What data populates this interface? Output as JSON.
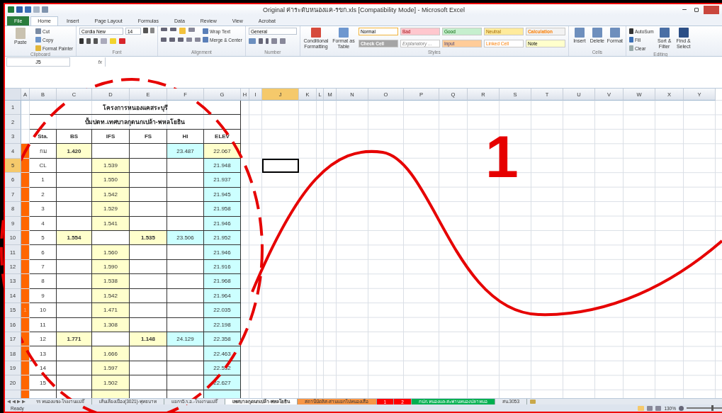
{
  "window": {
    "title": "Original ค่าระดับหนองแค-รขก.xls  [Compatibility Mode]  -  Microsoft Excel"
  },
  "tabs": [
    {
      "label": "File",
      "selected": false,
      "kind": "file"
    },
    {
      "label": "Home",
      "selected": true,
      "kind": "tab"
    },
    {
      "label": "Insert",
      "selected": false,
      "kind": "tab"
    },
    {
      "label": "Page Layout",
      "selected": false,
      "kind": "tab"
    },
    {
      "label": "Formulas",
      "selected": false,
      "kind": "tab"
    },
    {
      "label": "Data",
      "selected": false,
      "kind": "tab"
    },
    {
      "label": "Review",
      "selected": false,
      "kind": "tab"
    },
    {
      "label": "View",
      "selected": false,
      "kind": "tab"
    },
    {
      "label": "Acrobat",
      "selected": false,
      "kind": "tab"
    }
  ],
  "ribbon": {
    "clipboard": {
      "label": "Clipboard",
      "paste": "Paste",
      "cut": "Cut",
      "copy": "Copy",
      "painter": "Format Painter"
    },
    "font": {
      "label": "Font",
      "name": "Cordia New",
      "size": "14"
    },
    "alignment": {
      "label": "Alignment",
      "wrap": "Wrap Text",
      "merge": "Merge & Center"
    },
    "number": {
      "label": "Number",
      "format": "General"
    },
    "styles": {
      "label": "Styles",
      "conditional": "Conditional Formatting",
      "table": "Format as Table",
      "cells": [
        {
          "text": "Normal",
          "kind": "normal",
          "selected": true
        },
        {
          "text": "Bad",
          "kind": "bad",
          "selected": false
        },
        {
          "text": "Good",
          "kind": "good",
          "selected": false
        },
        {
          "text": "Neutral",
          "kind": "neutral",
          "selected": false
        },
        {
          "text": "Calculation",
          "kind": "calculation",
          "selected": false
        },
        {
          "text": "Check Cell",
          "kind": "check",
          "selected": false
        },
        {
          "text": "Explanatory ...",
          "kind": "explanatory",
          "selected": false
        },
        {
          "text": "Input",
          "kind": "input",
          "selected": false
        },
        {
          "text": "Linked Cell",
          "kind": "linked",
          "selected": false
        },
        {
          "text": "Note",
          "kind": "note",
          "selected": false
        }
      ]
    },
    "cells": {
      "label": "Cells",
      "buttons": [
        "Insert",
        "Delete",
        "Format"
      ]
    },
    "editing": {
      "label": "Editing",
      "autosum": "AutoSum",
      "fill": "Fill",
      "clear": "Clear",
      "sort": "Sort & Filter",
      "find": "Find & Select"
    }
  },
  "name_box": "J5",
  "function_label": "fx",
  "columns": [
    {
      "label": "A",
      "selected": false
    },
    {
      "label": "B",
      "selected": false
    },
    {
      "label": "C",
      "selected": false
    },
    {
      "label": "D",
      "selected": false
    },
    {
      "label": "E",
      "selected": false
    },
    {
      "label": "F",
      "selected": false
    },
    {
      "label": "G",
      "selected": false
    },
    {
      "label": "H",
      "selected": false
    },
    {
      "label": "I",
      "selected": false
    },
    {
      "label": "J",
      "selected": true
    },
    {
      "label": "K",
      "selected": false
    },
    {
      "label": "L",
      "selected": false
    },
    {
      "label": "M",
      "selected": false
    },
    {
      "label": "N",
      "selected": false
    },
    {
      "label": "O",
      "selected": false
    },
    {
      "label": "P",
      "selected": false
    },
    {
      "label": "Q",
      "selected": false
    },
    {
      "label": "R",
      "selected": false
    },
    {
      "label": "S",
      "selected": false
    },
    {
      "label": "T",
      "selected": false
    },
    {
      "label": "U",
      "selected": false
    },
    {
      "label": "V",
      "selected": false
    },
    {
      "label": "W",
      "selected": false
    },
    {
      "label": "X",
      "selected": false
    },
    {
      "label": "Y",
      "selected": false
    }
  ],
  "rows": [
    {
      "header": "1",
      "selected": false,
      "kind": "title",
      "text": "โครงการหนองแคสระบุรี"
    },
    {
      "header": "2",
      "selected": false,
      "kind": "title",
      "text": "ปั้มปตท.เทศบาลกุดนกเปล้า-พหลโยธิน"
    },
    {
      "header": "3",
      "selected": false,
      "kind": "data",
      "cells": [
        null,
        {
          "text": "Sta.",
          "bold": true
        },
        {
          "text": "BS",
          "bold": true
        },
        {
          "text": "IFS",
          "bold": true
        },
        {
          "text": "FS",
          "bold": true
        },
        {
          "text": "HI",
          "bold": true
        },
        {
          "text": "ELEV",
          "bold": true
        }
      ]
    },
    {
      "header": "4",
      "selected": false,
      "kind": "data",
      "cells": [
        {
          "color": "#ff6600"
        },
        {
          "text": "กม"
        },
        {
          "text": "1.420",
          "color": "#ffffcc",
          "bold": true
        },
        null,
        null,
        {
          "text": "23.487",
          "color": "#ccffff"
        },
        {
          "text": "22.067",
          "color": "#ffffcc"
        }
      ]
    },
    {
      "header": "5",
      "selected": true,
      "kind": "data",
      "cells": [
        {
          "color": "#ff6600"
        },
        {
          "text": "CL"
        },
        null,
        {
          "text": "1.539",
          "color": "#ffffcc"
        },
        null,
        null,
        {
          "text": "21.948",
          "color": "#ccffff"
        }
      ]
    },
    {
      "header": "6",
      "selected": false,
      "kind": "data",
      "cells": [
        {
          "color": "#ff6600"
        },
        {
          "text": "1"
        },
        null,
        {
          "text": "1.550",
          "color": "#ffffcc"
        },
        null,
        null,
        {
          "text": "21.937",
          "color": "#ccffff"
        }
      ]
    },
    {
      "header": "7",
      "selected": false,
      "kind": "data",
      "cells": [
        {
          "color": "#ff6600"
        },
        {
          "text": "2"
        },
        null,
        {
          "text": "1.542",
          "color": "#ffffcc"
        },
        null,
        null,
        {
          "text": "21.945",
          "color": "#ccffff"
        }
      ]
    },
    {
      "header": "8",
      "selected": false,
      "kind": "data",
      "cells": [
        {
          "color": "#ff6600"
        },
        {
          "text": "3"
        },
        null,
        {
          "text": "1.529",
          "color": "#ffffcc"
        },
        null,
        null,
        {
          "text": "21.958",
          "color": "#ccffff"
        }
      ]
    },
    {
      "header": "9",
      "selected": false,
      "kind": "data",
      "cells": [
        {
          "color": "#ff6600"
        },
        {
          "text": "4"
        },
        null,
        {
          "text": "1.541",
          "color": "#ffffcc"
        },
        null,
        null,
        {
          "text": "21.946",
          "color": "#ccffff"
        }
      ]
    },
    {
      "header": "10",
      "selected": false,
      "kind": "data",
      "cells": [
        {
          "color": "#ff6600"
        },
        {
          "text": "5"
        },
        {
          "text": "1.554",
          "color": "#ffffcc",
          "bold": true
        },
        null,
        {
          "text": "1.535",
          "color": "#ffffcc",
          "bold": true
        },
        {
          "text": "23.506",
          "color": "#ccffff"
        },
        {
          "text": "21.952",
          "color": "#ccffff"
        }
      ]
    },
    {
      "header": "11",
      "selected": false,
      "kind": "data",
      "cells": [
        {
          "color": "#ff6600"
        },
        {
          "text": "6"
        },
        null,
        {
          "text": "1.560",
          "color": "#ffffcc"
        },
        null,
        null,
        {
          "text": "21.946",
          "color": "#ccffff"
        }
      ]
    },
    {
      "header": "12",
      "selected": false,
      "kind": "data",
      "cells": [
        {
          "color": "#ff6600"
        },
        {
          "text": "7"
        },
        null,
        {
          "text": "1.590",
          "color": "#ffffcc"
        },
        null,
        null,
        {
          "text": "21.916",
          "color": "#ccffff"
        }
      ]
    },
    {
      "header": "13",
      "selected": false,
      "kind": "data",
      "cells": [
        {
          "color": "#ff6600"
        },
        {
          "text": "8"
        },
        null,
        {
          "text": "1.538",
          "color": "#ffffcc"
        },
        null,
        null,
        {
          "text": "21.968",
          "color": "#ccffff"
        }
      ]
    },
    {
      "header": "14",
      "selected": false,
      "kind": "data",
      "cells": [
        {
          "color": "#ff6600"
        },
        {
          "text": "9"
        },
        null,
        {
          "text": "1.542",
          "color": "#ffffcc"
        },
        null,
        null,
        {
          "text": "21.964",
          "color": "#ccffff"
        }
      ]
    },
    {
      "header": "15",
      "selected": false,
      "kind": "data",
      "cells": [
        {
          "color": "#ff6600",
          "text": "1"
        },
        {
          "text": "10"
        },
        null,
        {
          "text": "1.471",
          "color": "#ffffcc"
        },
        null,
        null,
        {
          "text": "22.035",
          "color": "#ccffff"
        }
      ]
    },
    {
      "header": "16",
      "selected": false,
      "kind": "data",
      "cells": [
        {
          "color": "#ff6600"
        },
        {
          "text": "11"
        },
        null,
        {
          "text": "1.308",
          "color": "#ffffcc"
        },
        null,
        null,
        {
          "text": "22.198",
          "color": "#ccffff"
        }
      ]
    },
    {
      "header": "17",
      "selected": false,
      "kind": "data",
      "cells": [
        {
          "color": "#ff6600"
        },
        {
          "text": "12"
        },
        {
          "text": "1.771",
          "color": "#ffffcc",
          "bold": true
        },
        null,
        {
          "text": "1.148",
          "color": "#ffffcc",
          "bold": true
        },
        {
          "text": "24.129",
          "color": "#ccffff"
        },
        {
          "text": "22.358",
          "color": "#ccffff"
        }
      ]
    },
    {
      "header": "18",
      "selected": false,
      "kind": "data",
      "cells": [
        {
          "color": "#ff6600"
        },
        {
          "text": "13"
        },
        null,
        {
          "text": "1.666",
          "color": "#ffffcc"
        },
        null,
        null,
        {
          "text": "22.463",
          "color": "#ccffff"
        }
      ]
    },
    {
      "header": "19",
      "selected": false,
      "kind": "data",
      "cells": [
        {
          "color": "#ff6600"
        },
        {
          "text": "14"
        },
        null,
        {
          "text": "1.597",
          "color": "#ffffcc"
        },
        null,
        null,
        {
          "text": "22.532",
          "color": "#ccffff"
        }
      ]
    },
    {
      "header": "20",
      "selected": false,
      "kind": "data",
      "cells": [
        {
          "color": "#ff6600"
        },
        {
          "text": "15"
        },
        null,
        {
          "text": "1.502",
          "color": "#ffffcc"
        },
        null,
        null,
        {
          "text": "22.627",
          "color": "#ccffff"
        }
      ]
    },
    {
      "selected": false,
      "kind": "data",
      "cells": [
        {
          "color": "#ff6600"
        },
        null,
        null,
        {
          "color": "#ffffcc"
        },
        null,
        null,
        {
          "color": "#ccffff"
        }
      ]
    }
  ],
  "sheet_tabs": [
    {
      "label": "รร หนองแซง-โรงงานแม่จ๊",
      "selected": false
    },
    {
      "label": "เส้นเลี่ยงเมือง(3021)-พุทธบาท",
      "selected": false
    },
    {
      "label": "แยกร5.ร.อ.-โรงงานแม่จ๊",
      "selected": false
    },
    {
      "label": "เทศบาลกุดนกเปล้า-พหลโยธิน",
      "selected": true
    },
    {
      "label": "สถานีบัดลิส-สามแยกไปหนองเสือ",
      "selected": false,
      "color": "#f79646"
    },
    {
      "label": "1",
      "selected": false,
      "color": "#ff0000"
    },
    {
      "label": "2",
      "selected": false,
      "color": "#ff0000"
    },
    {
      "label": "กปภ.หนองแค-สะพานหนองปลาหมอ",
      "selected": false,
      "color": "#00b050"
    },
    {
      "label": "สน.3053",
      "selected": false
    }
  ],
  "status_bar": {
    "text": "Ready",
    "zoom": "130%",
    "zoom_slider": {
      "level": 0.5
    }
  },
  "annotation": {
    "label": "1"
  }
}
